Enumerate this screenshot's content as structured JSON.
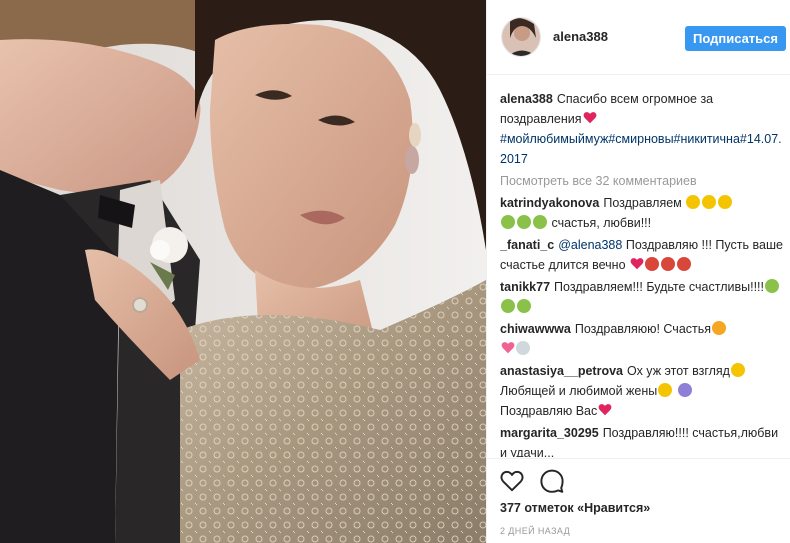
{
  "header": {
    "username": "alena388",
    "follow_label": "Подписаться"
  },
  "caption": {
    "username": "alena388",
    "text": "Спасибо всем огромное за поздравления",
    "hashtags": "#мойлюбимыймуж#смирновы#никитична#14.07.2017"
  },
  "view_all": "Посмотреть все 32 комментариев",
  "comments": [
    {
      "user": "katrindyakonova",
      "text": "Поздравляем",
      "text2": "счастья, любви!!!"
    },
    {
      "user": "_fanati_c",
      "mention": "@alena388",
      "text": "Поздравляю !!! Пусть ваше счастье длится вечно"
    },
    {
      "user": "tanikk77",
      "text": "Поздравляем!!! Будьте счастливы!!!!"
    },
    {
      "user": "chiwawwwa",
      "text": "Поздравляюю! Счастья"
    },
    {
      "user": "anastasiya__petrova",
      "text": "Ох уж этот взгляд",
      "text2": "Любящей и любимой жены",
      "text3": "Поздравляю Вас"
    },
    {
      "user": "margarita_30295",
      "text": "Поздравляю!!!! счастья,любви и удачи..."
    }
  ],
  "likes": "377 отметок «Нравится»",
  "timestamp": "2 ДНЕЙ НАЗАД",
  "icons": {
    "like": "heart-outline-icon",
    "comment": "speech-bubble-icon"
  },
  "colors": {
    "accent": "#3897f0",
    "hashtag": "#003569",
    "muted": "#999999"
  }
}
